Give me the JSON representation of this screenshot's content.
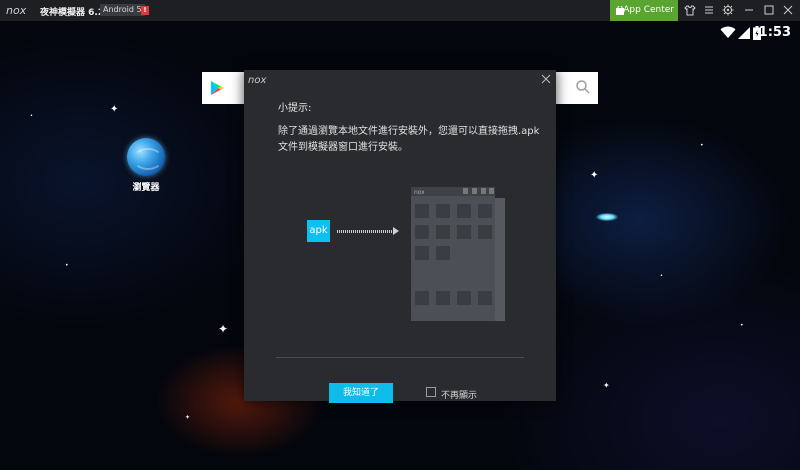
{
  "titlebar": {
    "app_title": "夜神模擬器 6.2.8.2",
    "android_version": "Android 5",
    "badge": "!",
    "app_center_label": "App Center"
  },
  "status_bar": {
    "time": "1:53"
  },
  "desktop": {
    "browser_app_label": "瀏覽器"
  },
  "dialog": {
    "title": "小提示:",
    "body": "除了通過瀏覽本地文件進行安裝外，您還可以直接拖拽.apk文件到模擬器窗口進行安裝。",
    "apk_label": "apk",
    "ok_button": "我知道了",
    "dont_show_label": "不再顯示",
    "dont_show_checked": false
  },
  "colors": {
    "titlebar_bg": "#1e1f22",
    "app_center_green": "#5aa531",
    "accent_cyan": "#0ebcec",
    "dialog_bg": "#2a2b2f"
  },
  "icons": [
    "nox-logo-icon",
    "shirt-icon",
    "menu-icon",
    "gear-icon",
    "minimize-icon",
    "maximize-icon",
    "close-icon",
    "wifi-icon",
    "signal-icon",
    "battery-icon",
    "play-store-icon",
    "search-icon",
    "browser-globe-icon",
    "arrow-right-icon"
  ]
}
